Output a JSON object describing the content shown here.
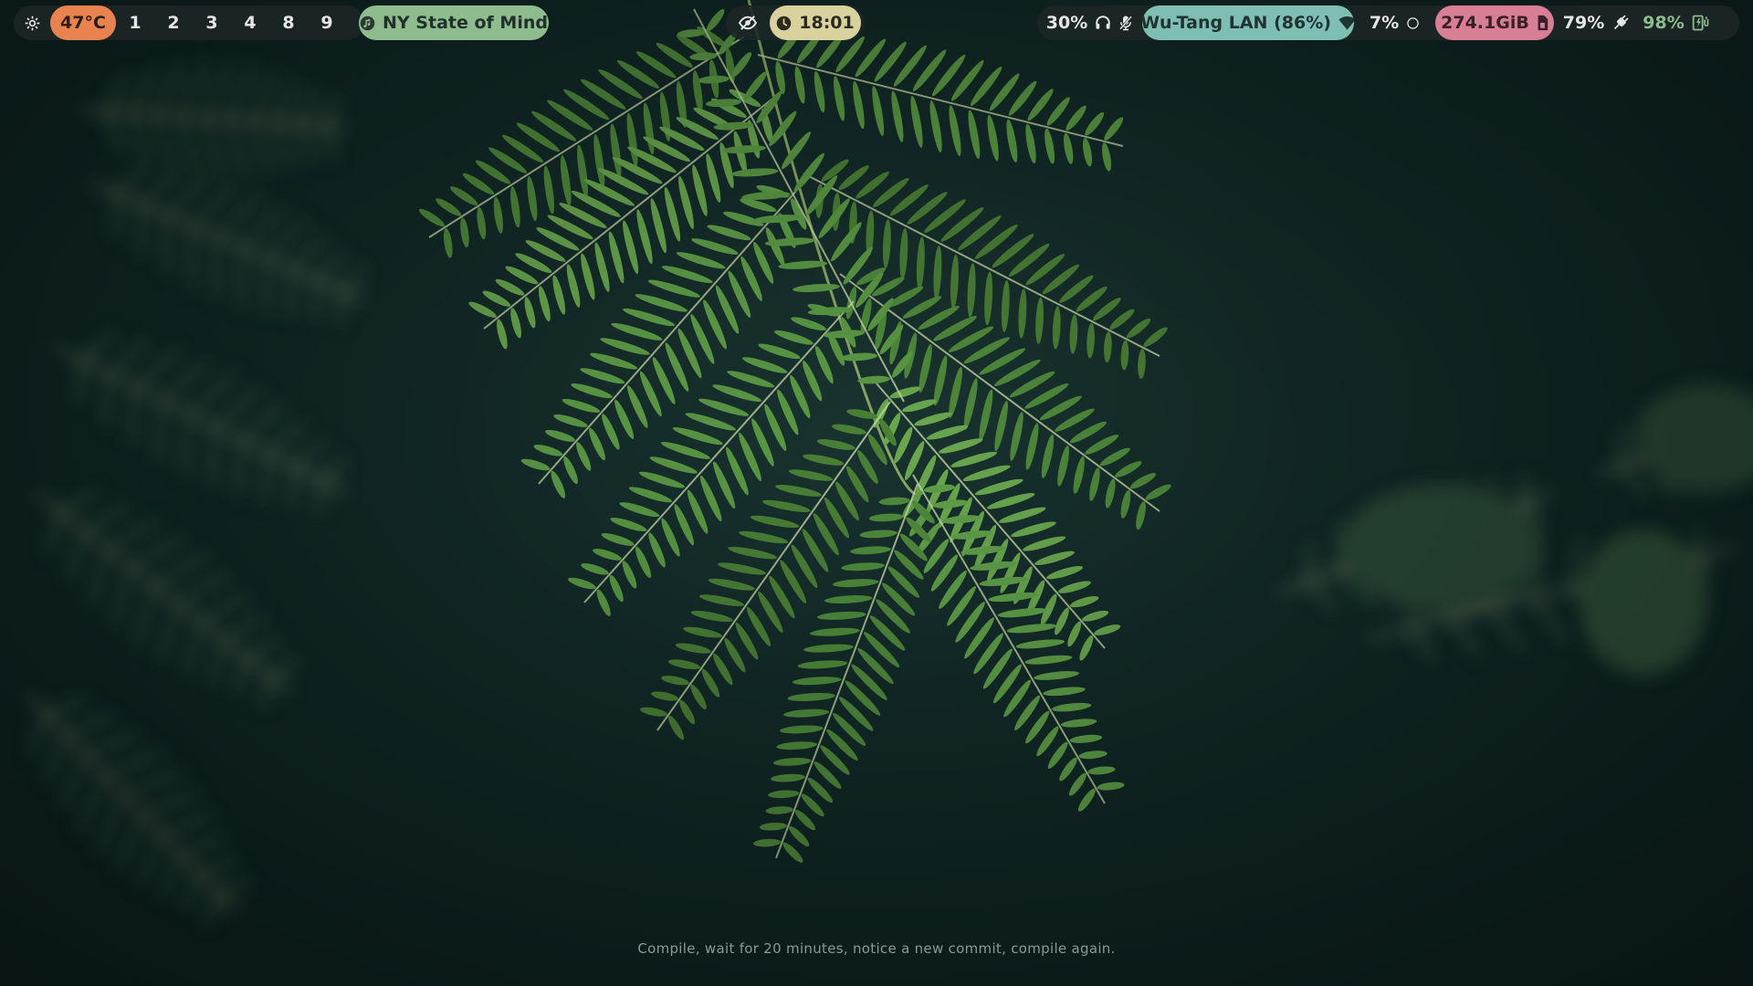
{
  "bar": {
    "left": {
      "settings_icon": "gear-icon",
      "temperature": "47°C",
      "workspaces": [
        "1",
        "2",
        "3",
        "4",
        "8",
        "9"
      ]
    },
    "media": {
      "icon": "music-note-icon",
      "title": "NY State of Mind"
    },
    "center": {
      "idle_inhibitor_icon": "eye-slash-icon",
      "clock_icon": "clock-icon",
      "time": "18:01"
    },
    "right": {
      "volume": "30%",
      "volume_icons": [
        "headphones-icon",
        "microphone-muted-icon"
      ],
      "network": "Wu-Tang LAN (86%)",
      "network_icon": "wifi-icon",
      "cpu": "7%",
      "cpu_icon": "circle-icon",
      "disk": "274.1GiB",
      "disk_icon": "sd-card-icon",
      "memory": "79%",
      "memory_icon": "plug-icon",
      "battery": "98%",
      "battery_icon": "battery-charging-icon"
    }
  },
  "motd": "Compile, wait for 20 minutes, notice a new commit, compile again.",
  "colors": {
    "temperature_bg": "#e8834f",
    "media_bg": "#8fbc8f",
    "clock_bg": "#d9d29e",
    "network_bg": "#7fbfb1",
    "disk_bg": "#d87f96",
    "battery_fg": "#8fbc8f",
    "bar_bg": "#1c2626"
  }
}
